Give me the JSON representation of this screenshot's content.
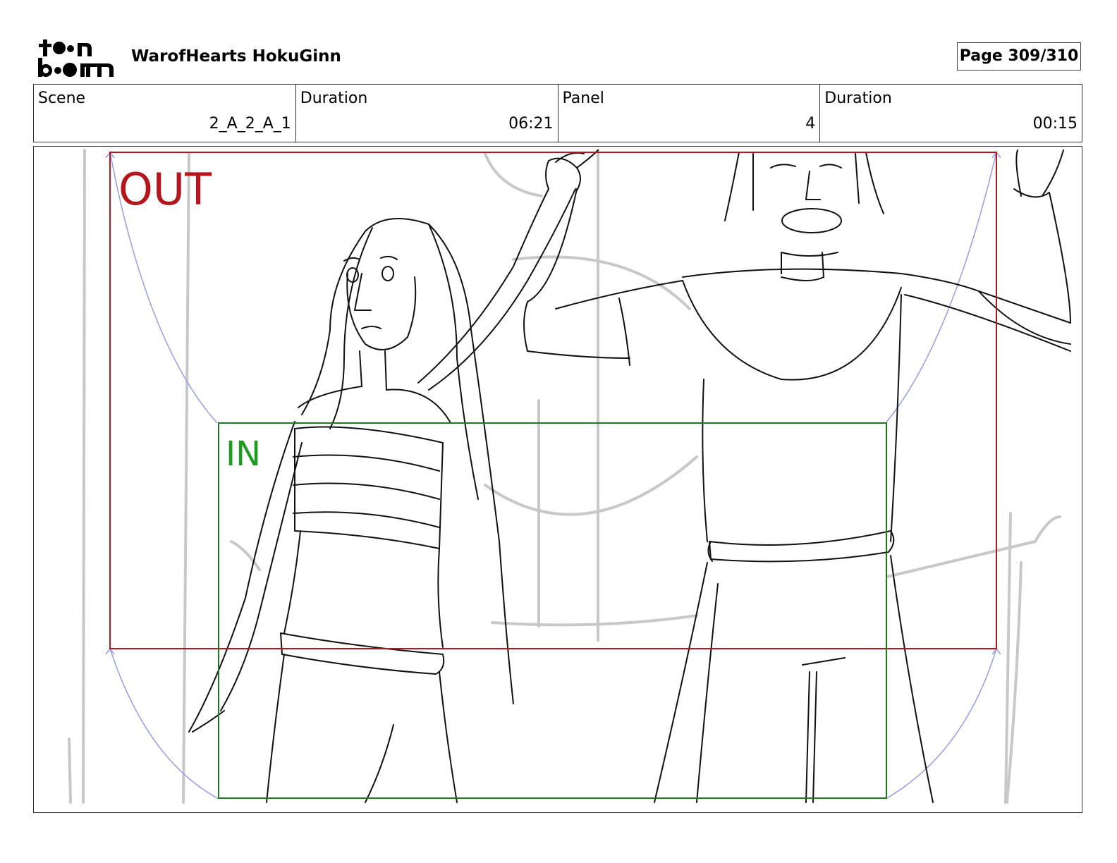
{
  "header": {
    "logo_text": "toon boom",
    "project_title": "WarofHearts HokuGinn",
    "page_indicator": "Page 309/310"
  },
  "info": {
    "scene_label": "Scene",
    "scene_value": "2_A_2_A_1",
    "scene_duration_label": "Duration",
    "scene_duration_value": "06:21",
    "panel_label": "Panel",
    "panel_value": "4",
    "panel_duration_label": "Duration",
    "panel_duration_value": "00:15"
  },
  "panel_frames": {
    "out_label": "OUT",
    "in_label": "IN",
    "out_color": "#b5161b",
    "in_color": "#1f9b1f"
  }
}
